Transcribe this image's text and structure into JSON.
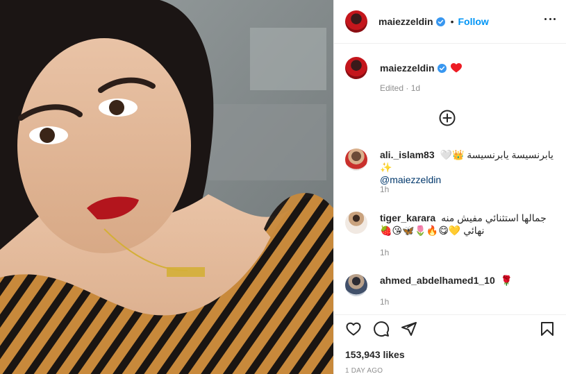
{
  "post": {
    "author": "maiezzeldin",
    "follow_label": "Follow",
    "separator": "•",
    "caption_emoji": "heart-emoji",
    "edited_label": "Edited · 1d",
    "likes": "153,943 likes",
    "date": "1 DAY AGO"
  },
  "comments": [
    {
      "username": "ali._islam83",
      "text": "يابرنسيسة يابرنسيسة 👑🤍✨",
      "mention": "@maiezzeldin",
      "time": "1h"
    },
    {
      "username": "tiger_karara",
      "text": "جمالها استثنائي مفيش منه نهائي 💛😋🔥🌷🦋😘🍓",
      "time": "1h"
    },
    {
      "username": "ahmed_abdelhamed1_10",
      "text": "🌹",
      "time": "1h"
    }
  ],
  "icons": {
    "verified": "verified-badge-icon",
    "more": "more-options-icon",
    "load_more": "plus-circle-icon",
    "like": "heart-outline-icon",
    "comment": "comment-icon",
    "share": "share-icon",
    "save": "bookmark-icon"
  },
  "colors": {
    "accent": "#0095f6",
    "verified": "#3897f0",
    "heart": "#ed1c24",
    "text": "#262626",
    "muted": "#8e8e8e",
    "border": "#efefef"
  }
}
